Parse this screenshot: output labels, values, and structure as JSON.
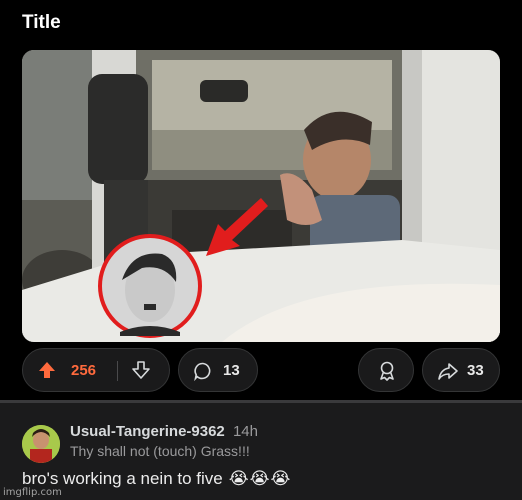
{
  "post": {
    "title": "Title"
  },
  "actions": {
    "upvote_count": "256",
    "comment_count": "13",
    "share_count": "33",
    "upvote_color": "#ff6a3d"
  },
  "comment": {
    "username": "Usual-Tangerine-9362",
    "time": "14h",
    "flair": "Thy shall not (touch) Grass!!!",
    "text": "bro's working a nein to five",
    "emojis": "😭😭😭"
  },
  "watermark": "imgflip.com",
  "icons": [
    "upvote-arrow-icon",
    "downvote-arrow-icon",
    "comment-bubble-icon",
    "award-icon",
    "share-arrow-icon"
  ]
}
